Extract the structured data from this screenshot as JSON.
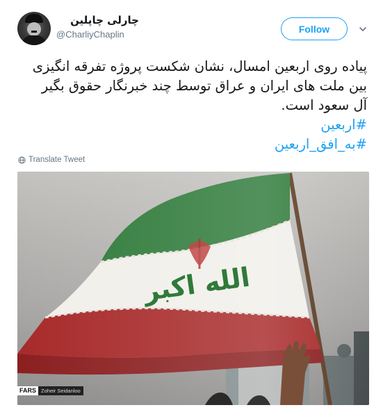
{
  "tweet": {
    "display_name": "چارلی چاپلین",
    "handle": "@CharliyChaplin",
    "follow_label": "Follow",
    "text_lines": [
      "پیاده روی اربعین امسال، نشان شکست پروژه تفرقه انگیزی",
      "بین ملت های ایران و عراق توسط چند خبرنگار حقوق بگیر",
      "آل سعود است."
    ],
    "hashtags": [
      "#اربعین",
      "#به_افق_اربعین"
    ],
    "translate_label": "Translate Tweet",
    "media": {
      "flag_takbir_text": "الله اکبر",
      "agency_label": "FARS",
      "photographer": "Zoheir Seidanloo"
    }
  },
  "icons": {
    "more": "chevron-down-icon",
    "translate": "globe-icon"
  },
  "colors": {
    "accent": "#1da1f2",
    "text": "#14171a",
    "secondary": "#657786",
    "flag_green": "#2f7a3a",
    "flag_white": "#f4f2ee",
    "flag_red": "#a82a2a"
  }
}
